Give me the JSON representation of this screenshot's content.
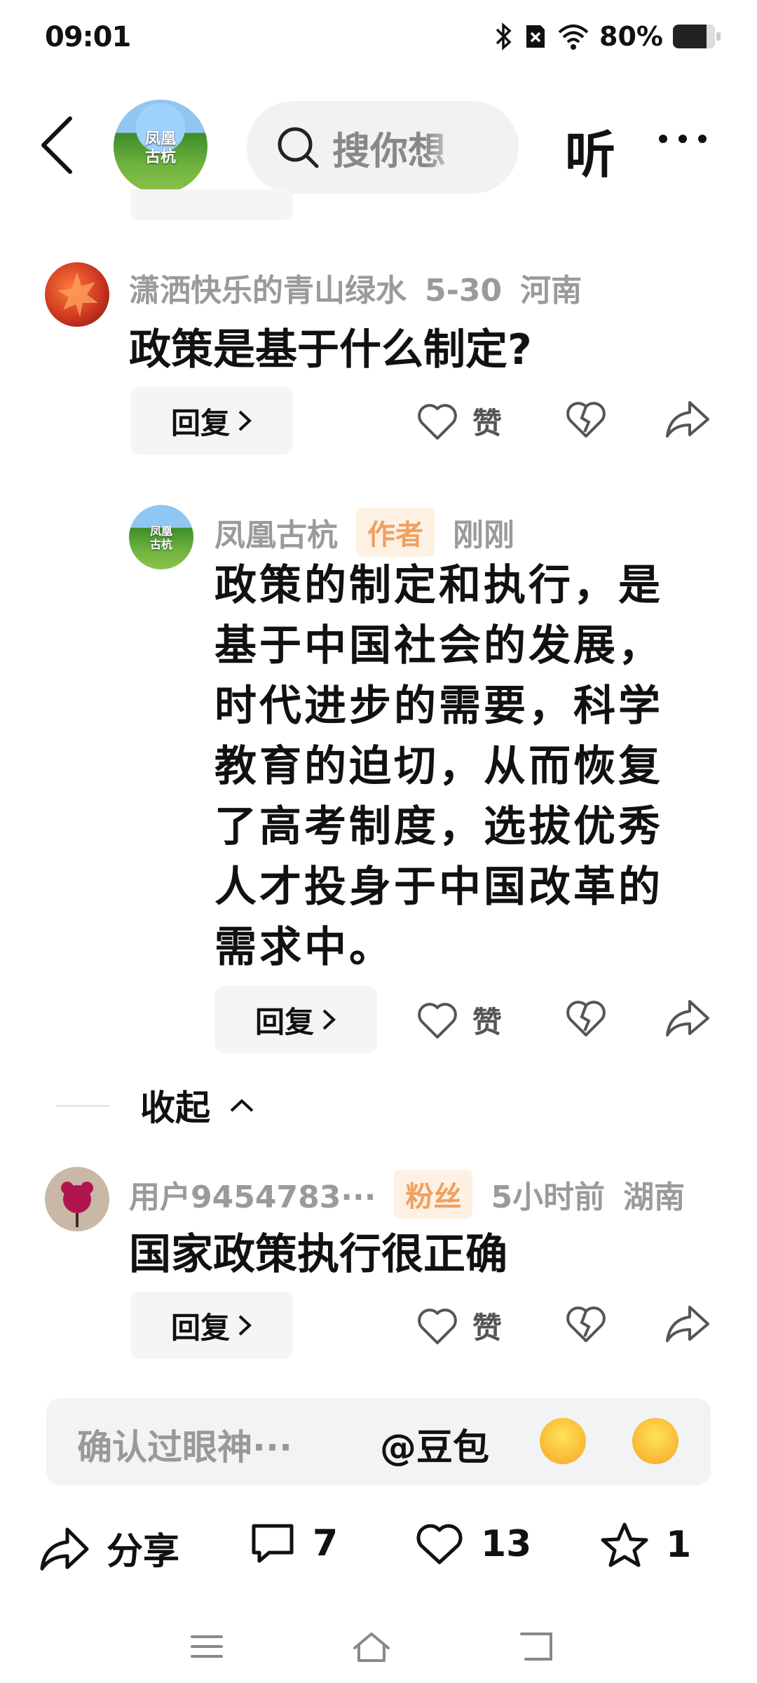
{
  "status_bar": {
    "time": "09:01",
    "battery": "80%"
  },
  "header": {
    "logo_text_line1": "凤凰",
    "logo_text_line2": "古杭",
    "search_placeholder": "搜你想",
    "listen": "听"
  },
  "comments": [
    {
      "user": "潇洒快乐的青山绿水",
      "date": "5-30",
      "location": "河南",
      "text": "政策是基于什么制定?",
      "reply_label": "回复",
      "like_label": "赞"
    },
    {
      "user": "凤凰古杭",
      "badge": "作者",
      "date": "刚刚",
      "text": "政策的制定和执行，是基于中国社会的发展，时代进步的需要，科学教育的迫切，从而恢复了高考制度，选拔优秀人才投身于中国改革的需求中。",
      "reply_label": "回复",
      "like_label": "赞",
      "avatar_text_line1": "凤凰",
      "avatar_text_line2": "古杭"
    },
    {
      "user": "用户9454783···",
      "badge": "粉丝",
      "date": "5小时前",
      "location": "湖南",
      "text": "国家政策执行很正确",
      "reply_label": "回复",
      "like_label": "赞"
    }
  ],
  "collapse_label": "收起",
  "input": {
    "placeholder": "确认过眼神···",
    "mention": "@豆包"
  },
  "bottom_bar": {
    "share": "分享",
    "comments": "7",
    "likes": "13",
    "favorites": "1"
  },
  "colors": {
    "badge_bg": "#fdf1e3",
    "badge_text": "#f0a060",
    "meta_gray": "#9a9a9a"
  }
}
